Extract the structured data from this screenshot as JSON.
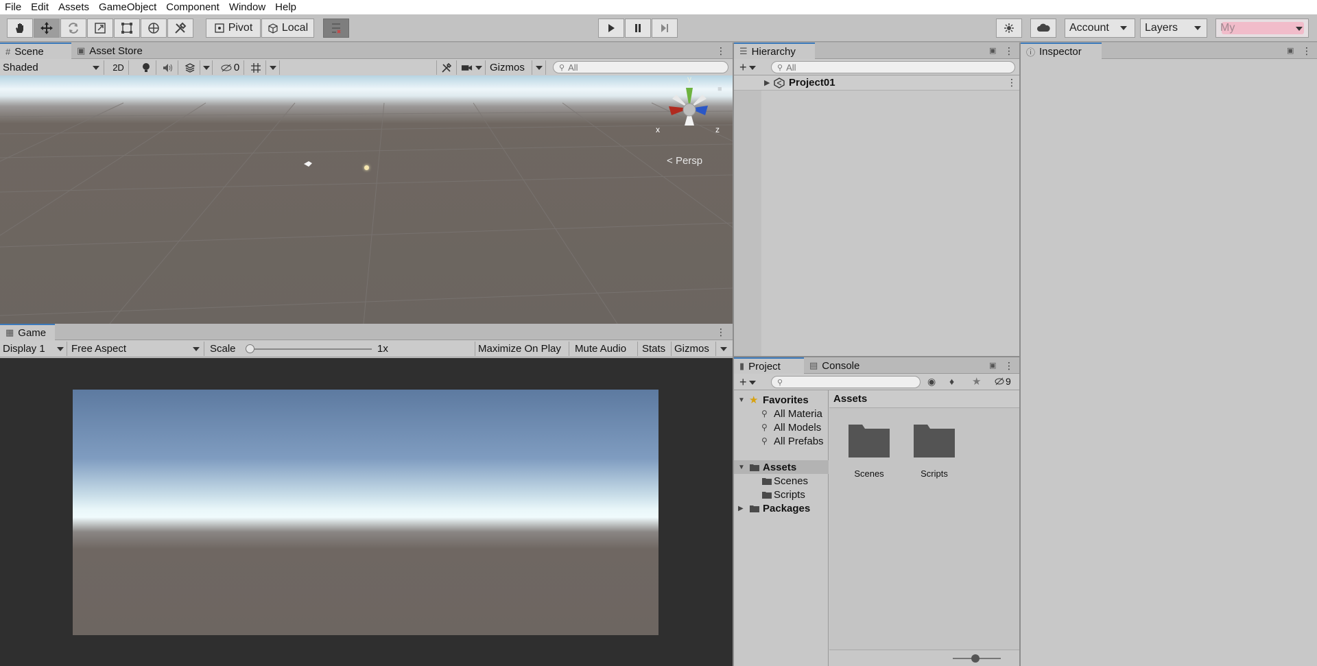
{
  "menu": [
    "File",
    "Edit",
    "Assets",
    "GameObject",
    "Component",
    "Window",
    "Help"
  ],
  "toolbar": {
    "pivot_label": "Pivot",
    "local_label": "Local",
    "account_label": "Account",
    "layers_label": "Layers",
    "layout_label": "My"
  },
  "scene": {
    "tabs": [
      "Scene",
      "Asset Store"
    ],
    "shading_mode": "Shaded",
    "mode_2d": "2D",
    "hidden_count": "0",
    "gizmos_label": "Gizmos",
    "search_placeholder": "All",
    "gizmo_axes": {
      "x": "x",
      "y": "y",
      "z": "z"
    },
    "persp_label": "Persp"
  },
  "game": {
    "tab": "Game",
    "display": "Display 1",
    "aspect": "Free Aspect",
    "scale_label": "Scale",
    "scale_value": "1x",
    "maximize_label": "Maximize On Play",
    "mute_label": "Mute Audio",
    "stats_label": "Stats",
    "gizmos_label": "Gizmos"
  },
  "hierarchy": {
    "tab": "Hierarchy",
    "search_placeholder": "All",
    "root_item": "Project01"
  },
  "project": {
    "tabs": [
      "Project",
      "Console"
    ],
    "hidden_count": "9",
    "favorites_label": "Favorites",
    "favorites": [
      "All Materia",
      "All Models",
      "All Prefabs"
    ],
    "assets_label": "Assets",
    "asset_folders": [
      "Scenes",
      "Scripts"
    ],
    "packages_label": "Packages",
    "breadcrumb": "Assets",
    "grid_items": [
      "Scenes",
      "Scripts"
    ]
  },
  "inspector": {
    "tab": "Inspector"
  },
  "colors": {
    "accent_tab": "#3a79bb",
    "panel_bg": "#c8c8c8",
    "game_bg": "#2f2f2f",
    "layout_highlight": "#f2b8c8"
  }
}
